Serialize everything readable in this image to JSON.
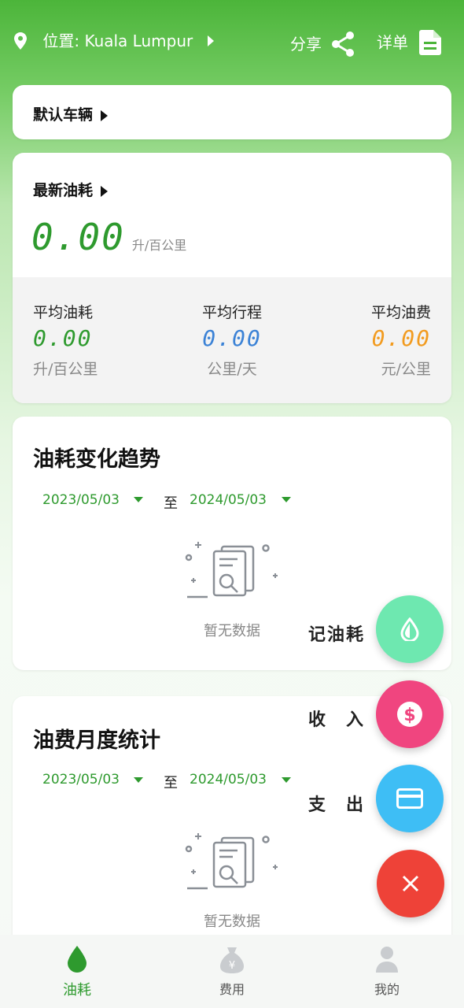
{
  "header": {
    "location": "位置: Kuala Lumpur",
    "share_label": "分享",
    "detail_label": "详单"
  },
  "vehicle_card": {
    "title": "默认车辆"
  },
  "latest_card": {
    "title": "最新油耗",
    "value": "0.00",
    "unit": "升/百公里",
    "stats": [
      {
        "label": "平均油耗",
        "value": "0.00",
        "unit": "升/百公里",
        "color": "#2e9a2e"
      },
      {
        "label": "平均行程",
        "value": "0.00",
        "unit": "公里/天",
        "color": "#3b82d6"
      },
      {
        "label": "平均油费",
        "value": "0.00",
        "unit": "元/公里",
        "color": "#f29b1f"
      }
    ]
  },
  "trend_card": {
    "title": "油耗变化趋势",
    "start_date": "2023/05/03",
    "to_label": "至",
    "end_date": "2024/05/03",
    "empty_text": "暂无数据"
  },
  "monthly_card": {
    "title": "油费月度统计",
    "start_date": "2023/05/03",
    "to_label": "至",
    "end_date": "2024/05/03",
    "empty_text": "暂无数据"
  },
  "fab_menu": {
    "fuel_label": "记油耗",
    "income_label": "收　入",
    "expense_label": "支　出",
    "colors": {
      "fuel": "#6ee8b0",
      "income": "#f0457f",
      "expense": "#3ebef5",
      "close": "#ee4238"
    }
  },
  "bottom_nav": {
    "items": [
      {
        "label": "油耗",
        "icon": "drop-icon",
        "active": true
      },
      {
        "label": "费用",
        "icon": "money-bag-icon",
        "active": false
      },
      {
        "label": "我的",
        "icon": "person-icon",
        "active": false
      }
    ],
    "active_color": "#2e9a2e"
  }
}
